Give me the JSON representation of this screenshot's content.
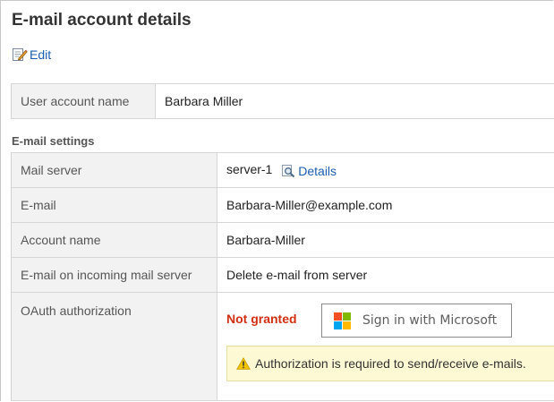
{
  "page": {
    "title": "E-mail account details",
    "edit_label": "Edit"
  },
  "user_table": {
    "label": "User account name",
    "value": "Barbara Miller"
  },
  "email_settings": {
    "section_title": "E-mail settings",
    "rows": [
      {
        "label": "Mail server",
        "value": "server-1",
        "link_label": "Details"
      },
      {
        "label": "E-mail",
        "value": "Barbara-Miller@example.com"
      },
      {
        "label": "Account name",
        "value": "Barbara-Miller"
      },
      {
        "label": "E-mail on incoming mail server",
        "value": "Delete e-mail from server"
      },
      {
        "label": "OAuth authorization"
      }
    ],
    "oauth": {
      "status": "Not granted",
      "status_color": "#d12f12",
      "button_label": "Sign in with Microsoft",
      "warning_text": "Authorization is required to send/receive e-mails."
    }
  },
  "colors": {
    "link": "#1a5fb4",
    "label_bg": "#f2f2f2",
    "warning_bg": "#fdf9d4"
  },
  "icons": {
    "edit": "edit-pencil-icon",
    "details": "magnifier-details-icon",
    "warning": "warning-triangle-icon",
    "microsoft": "microsoft-logo-icon"
  }
}
